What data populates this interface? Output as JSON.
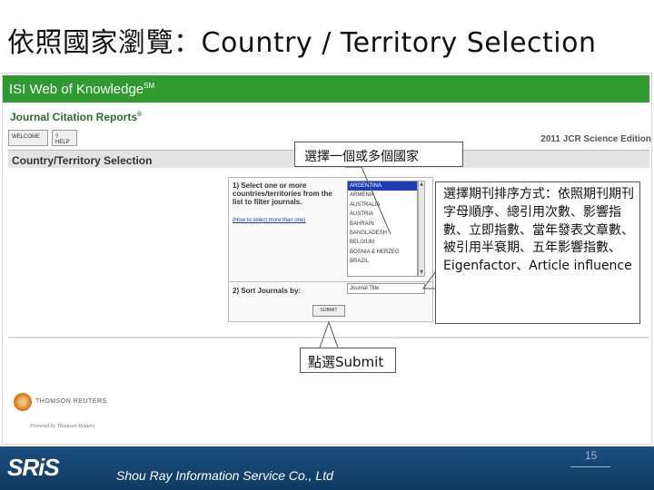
{
  "slide": {
    "title": "依照國家瀏覽：Country / Territory Selection",
    "page_number": "15",
    "company": "Shou Ray Information Service Co., Ltd",
    "logo_text": "SRiS"
  },
  "screenshot": {
    "isi_header": "ISI Web of Knowledge",
    "isi_header_mark": "SM",
    "jcr_title": "Journal Citation Reports",
    "jcr_mark": "®",
    "welcome_label": "WELCOME",
    "help_label": "? HELP",
    "edition": "2011 JCR Science Edition",
    "section_title": "Country/Territory Selection",
    "step1_label": "1) Select one or more countries/territories from the list to filter journals.",
    "howto_link": "(How to select more than one)",
    "countries": [
      "ARGENTINA",
      "ARMENIA",
      "AUSTRALIA",
      "AUSTRIA",
      "BAHRAIN",
      "BANGLADESH",
      "BELGIUM",
      "BOSNIA & HERZEG",
      "BRAZIL"
    ],
    "selected_country_index": 0,
    "step2_label": "2) Sort Journals by:",
    "sort_value": "Journal Title",
    "submit_label": "SUBMIT",
    "thomson_name": "THOMSON REUTERS",
    "powered_by": "Powered by Thomson Reuters"
  },
  "callouts": {
    "select_countries": "選擇一個或多個國家",
    "sort_method": "選擇期刊排序方式：依照期刊期刊字母順序、總引用次數、影響指數、立即指數、當年發表文章數、被引用半衰期、五年影響指數、Eigenfactor、Article influence",
    "click_submit": "點選Submit"
  },
  "colors": {
    "isi_green": "#2f9a2f",
    "selection_blue": "#1f3fb5",
    "footer_blue": "#1a4f7e"
  }
}
